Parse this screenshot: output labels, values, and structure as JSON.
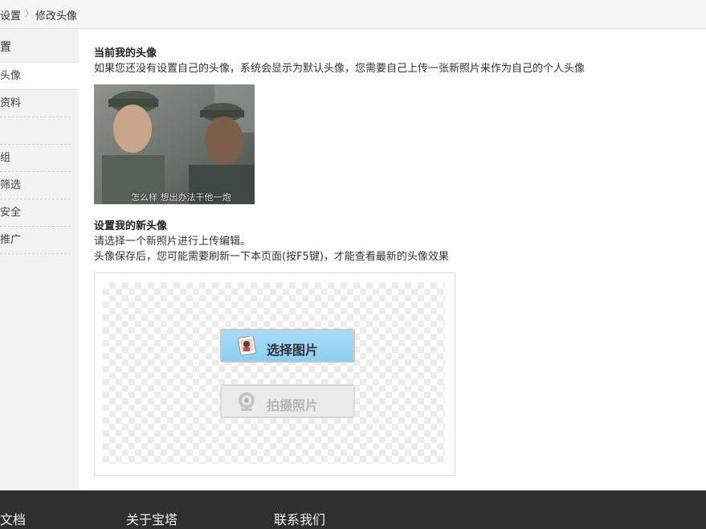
{
  "breadcrumb": {
    "parent": "设置",
    "current": "修改头像"
  },
  "sidebar": {
    "heading": "置",
    "items": [
      {
        "label": "头像",
        "active": true
      },
      {
        "label": "资料",
        "active": false
      },
      {
        "label": "",
        "active": false
      },
      {
        "label": "组",
        "active": false
      },
      {
        "label": "筛选",
        "active": false
      },
      {
        "label": "安全",
        "active": false
      },
      {
        "label": "推广",
        "active": false
      }
    ]
  },
  "current_avatar": {
    "title": "当前我的头像",
    "description": "如果您还没有设置自己的头像，系统会显示为默认头像，您需要自己上传一张新照片来作为自己的个人头像",
    "image_caption": "怎么样 想出办法干他一炮"
  },
  "new_avatar": {
    "title": "设置我的新头像",
    "line1": "请选择一个新照片进行上传编辑。",
    "line2": "头像保存后，您可能需要刷新一下本页面(按F5键)，才能查看最新的头像效果",
    "select_button": "选择图片",
    "photo_button": "拍摄照片"
  },
  "footer": {
    "links": [
      "文档",
      "关于宝塔",
      "联系我们"
    ]
  },
  "colors": {
    "select_button_bg": "#8bcff3",
    "footer_bg": "#2f2f2f",
    "sidebar_bg": "#f2f2f2"
  },
  "icons": {
    "select_button": "portrait-photo-icon",
    "photo_button": "webcam-icon"
  }
}
